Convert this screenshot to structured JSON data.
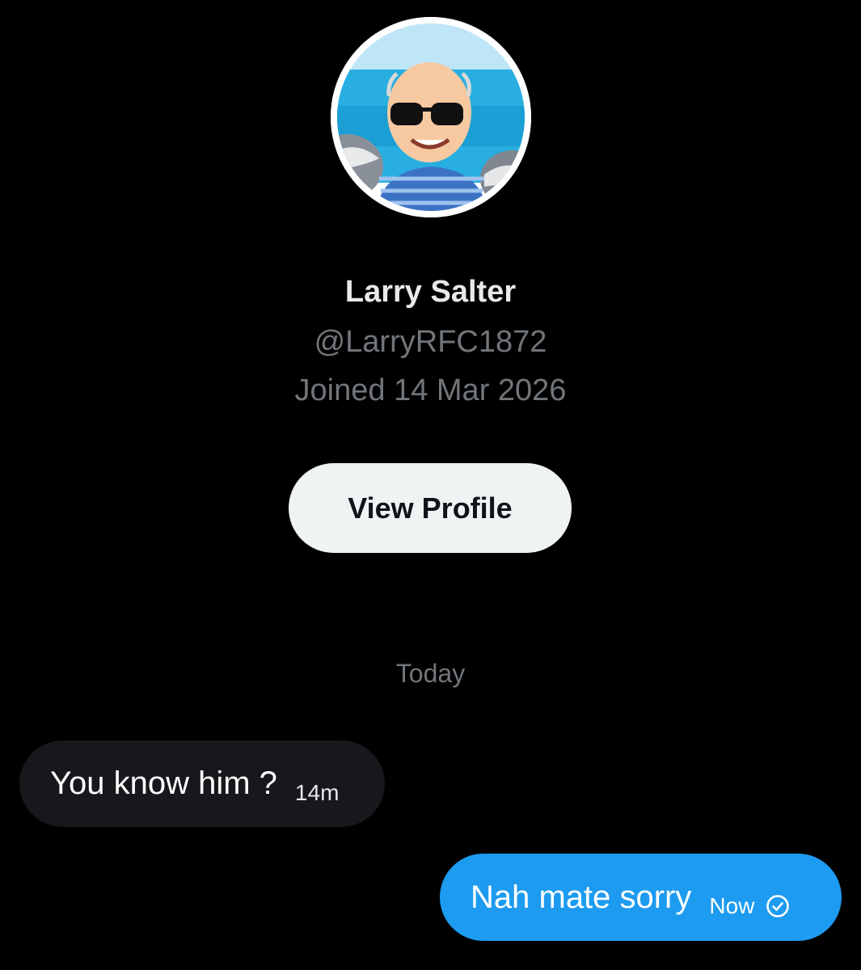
{
  "profile": {
    "name": "Larry Salter",
    "handle": "@LarryRFC1872",
    "joined": "Joined 14 Mar 2026",
    "view_profile_label": "View Profile"
  },
  "conversation": {
    "day_separator": "Today",
    "messages": [
      {
        "direction": "incoming",
        "text": "You know him ?",
        "time": "14m"
      },
      {
        "direction": "outgoing",
        "text": "Nah mate sorry",
        "time": "Now",
        "status_icon": "check-circle-icon"
      }
    ]
  },
  "colors": {
    "background": "#000000",
    "outgoing_bubble": "#1d9bf0",
    "incoming_bubble": "#16181c",
    "secondary_text": "#71767b",
    "button_bg": "#eff3f4"
  }
}
